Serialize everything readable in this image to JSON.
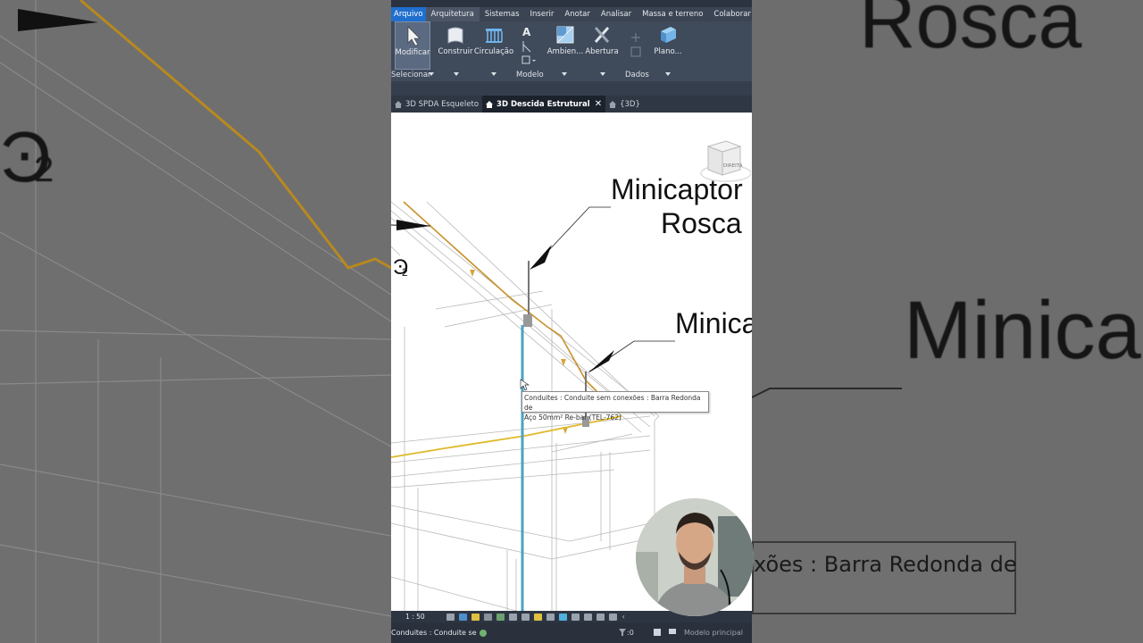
{
  "background": {
    "left_text_2": "2",
    "right_text_rosca": "Rosca",
    "right_text_minica": "Minica",
    "right_tooltip": "xões : Barra Redonda de"
  },
  "menubar": {
    "items": [
      "Arquivo",
      "Arquitetura",
      "Sistemas",
      "Inserir",
      "Anotar",
      "Analisar",
      "Massa e terreno",
      "Colaborar"
    ]
  },
  "ribbon": {
    "buttons": [
      "Modificar",
      "Construir",
      "Circulação",
      "Ambien...",
      "Abertura",
      "Plano..."
    ],
    "groups": {
      "select": "Selecionar",
      "model": "Modelo",
      "data": "Dados"
    }
  },
  "view_tabs": [
    {
      "label": "3D SPDA Esqueleto",
      "active": false
    },
    {
      "label": "3D Descida Estrutural",
      "active": true
    },
    {
      "label": "{3D}",
      "active": false
    }
  ],
  "viewport": {
    "callout_1_line1": "Minicaptor",
    "callout_1_line2": "Rosca",
    "callout_2": "Minica",
    "subscript_2": "2",
    "viewcube_label": "DIREITA",
    "tooltip_line1": "Conduites : Conduite sem conexões : Barra Redonda de",
    "tooltip_line2": "Aço 50mm² Re-bar (TEL-762)"
  },
  "statusbar": {
    "scale": "1 : 50"
  },
  "bottombar": {
    "status_text": "Conduites : Conduite se",
    "selection_count": ":0",
    "model": "Modelo principal"
  },
  "colors": {
    "ribbon_bg": "#3f4a5b",
    "accent_blue": "#1f6fcf",
    "conduit_orange": "#c8922a",
    "conduit_yellow": "#e0b92a",
    "descent_blue": "#4aa3c4"
  }
}
